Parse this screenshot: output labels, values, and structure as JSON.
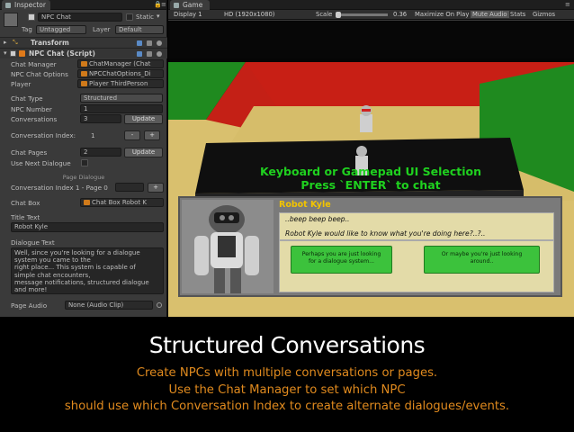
{
  "inspector": {
    "tab": "Inspector",
    "object_name": "NPC Chat",
    "static_label": "Static",
    "tag_label": "Tag",
    "tag_value": "Untagged",
    "layer_label": "Layer",
    "layer_value": "Default",
    "transform_label": "Transform",
    "script_label": "NPC Chat (Script)",
    "fields": {
      "chat_manager": {
        "label": "Chat Manager",
        "value": "ChatManager (Chat"
      },
      "npc_chat_options": {
        "label": "NPC Chat Options",
        "value": "NPCChatOptions_Di"
      },
      "player": {
        "label": "Player",
        "value": "Player ThirdPerson"
      },
      "chat_type": {
        "label": "Chat Type",
        "value": "Structured"
      },
      "npc_number": {
        "label": "NPC Number",
        "value": "1"
      },
      "conversations": {
        "label": "Conversations",
        "value": "3"
      },
      "update1": "Update",
      "conversation_index": {
        "label": "Conversation Index:",
        "value": "1"
      },
      "minus": "-",
      "plus": "+",
      "chat_pages": {
        "label": "Chat Pages",
        "value": "2"
      },
      "update2": "Update",
      "use_next_dialogue": {
        "label": "Use Next Dialogue"
      },
      "page_dialogue_heading": "Page Dialogue",
      "conv_page": {
        "label": "Conversation Index 1 - Page 0"
      },
      "plus2": "+",
      "chat_box": {
        "label": "Chat Box",
        "value": "Chat Box Robot K"
      },
      "title_text": {
        "label": "Title Text",
        "value": "Robot Kyle"
      },
      "dialogue_text": {
        "label": "Dialogue Text",
        "lines": [
          "Well, since you're looking for a dialogue",
          "system you came to the",
          "right place... This system is capable of",
          "simple chat encounters,",
          "message notifications, structured dialogue",
          "and more!"
        ]
      },
      "page_audio": {
        "label": "Page Audio",
        "value": "None (Audio Clip)"
      }
    }
  },
  "game": {
    "tab": "Game",
    "display": "Display 1",
    "resolution": "HD (1920x1080)",
    "scale_label": "Scale",
    "scale_value": "0.36",
    "toggles": [
      "Maximize On Play",
      "Mute Audio",
      "Stats",
      "Gizmos"
    ],
    "sign_line1": "Keyboard or Gamepad UI Selection",
    "sign_line2": "Press `ENTER` to chat",
    "dialogue": {
      "title": "Robot Kyle",
      "line1": "..beep beep beep..",
      "line2": "Robot Kyle would like to know what you're doing here?..?..",
      "option1": "Perhaps you are just looking for a dialogue system...",
      "option2": "Or maybe you're just looking around.."
    }
  },
  "footer": {
    "title": "Structured Conversations",
    "lines": [
      "Create NPCs with multiple conversations or pages.",
      "Use the Chat Manager to set which NPC",
      "should use which Conversation Index to create alternate dialogues/events."
    ]
  },
  "colors": {
    "accent_orange": "#e08a1e",
    "green_button": "#3cc23c",
    "sign_green": "#1fd11f"
  }
}
